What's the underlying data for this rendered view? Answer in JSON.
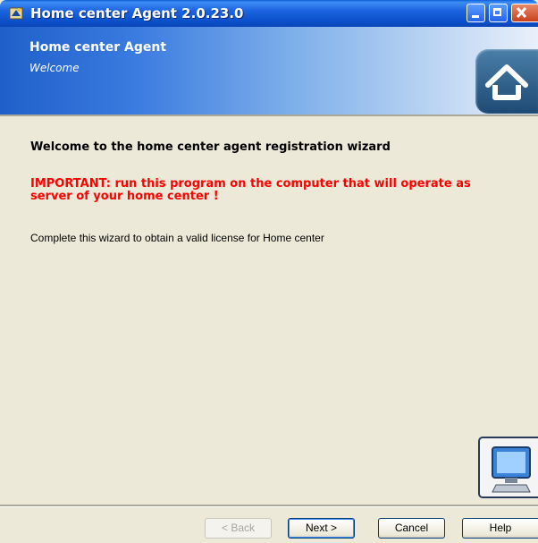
{
  "window": {
    "title": "Home center Agent 2.0.23.0",
    "controls": [
      "minimize-icon",
      "maximize-icon",
      "close-icon"
    ]
  },
  "header": {
    "title": "Home center Agent",
    "subtitle": "Welcome",
    "logo_icon": "home-icon"
  },
  "content": {
    "heading": "Welcome to the home center agent registration wizard",
    "important": "IMPORTANT: run this program on the computer that will operate as server of your home center !",
    "instruction": "Complete this wizard to obtain a valid license for Home center",
    "side_image_icon": "computer-icon",
    "important_color": "#ff0000"
  },
  "buttons": {
    "back": "< Back",
    "next": "Next >",
    "cancel": "Cancel",
    "help": "Help"
  }
}
